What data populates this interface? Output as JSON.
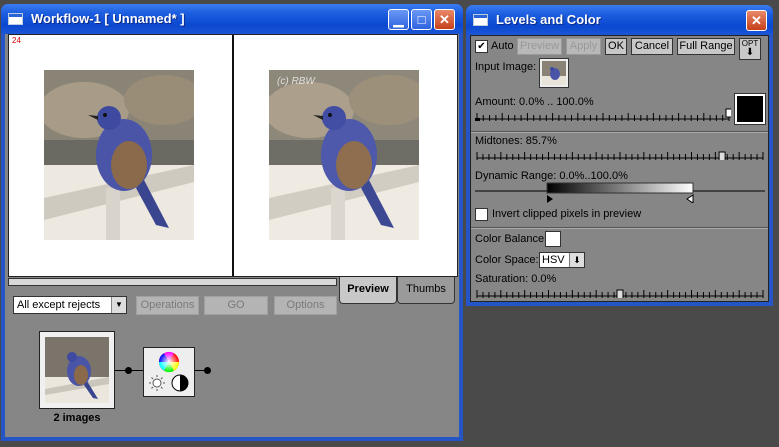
{
  "workflow": {
    "title": "Workflow-1 [ Unnamed* ]",
    "frame_number": "24",
    "watermark": "(c) RBW",
    "filter": "All except rejects",
    "operations_label": "Operations",
    "go_label": "GO",
    "options_label": "Options",
    "tabs": [
      "Preview",
      "Thumbs"
    ],
    "node_label": "2 images"
  },
  "levels": {
    "title": "Levels and Color",
    "auto_label": "Auto",
    "auto_checked": true,
    "preview_label": "Preview",
    "apply_label": "Apply",
    "ok_label": "OK",
    "cancel_label": "Cancel",
    "full_range_label": "Full Range",
    "opt_label": "OPT",
    "input_image_label": "Input Image:",
    "amount_label": "Amount: 0.0% .. 100.0%",
    "midtones_label": "Midtones: 85.7%",
    "midtones_value": 85.7,
    "dynamic_range_label": "Dynamic Range: 0.0%..100.0%",
    "invert_label": "Invert clipped pixels in preview",
    "invert_checked": false,
    "color_balance_label": "Color Balance:",
    "color_space_label": "Color Space:",
    "color_space_value": "HSV",
    "saturation_label": "Saturation: 0.0%",
    "saturation_value": 0.0
  },
  "colors": {
    "title_blue": "#0b48d0",
    "panel_gray": "#868686",
    "desktop": "#4a4a4a"
  }
}
